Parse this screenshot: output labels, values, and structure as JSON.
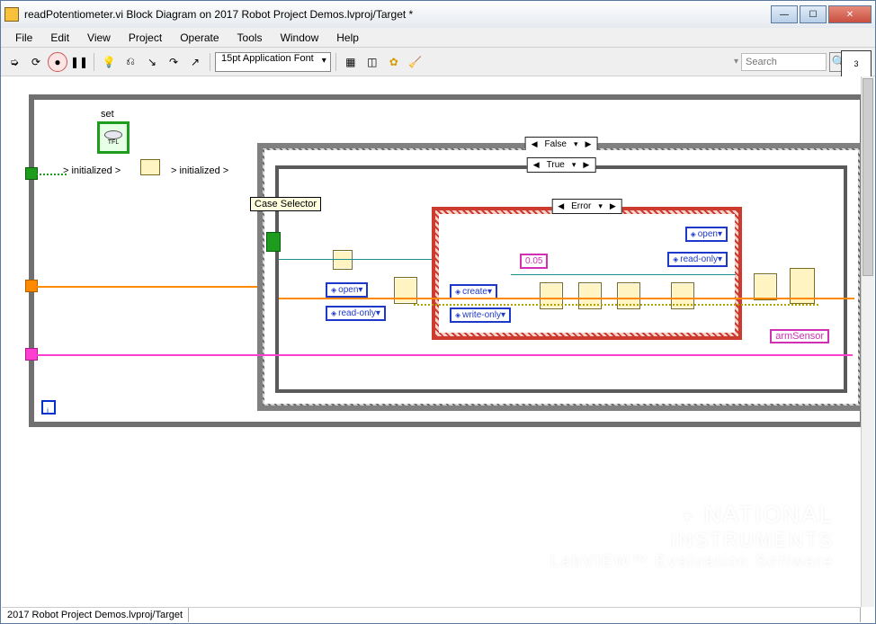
{
  "window": {
    "title": "readPotentiometer.vi Block Diagram on 2017 Robot Project Demos.lvproj/Target *"
  },
  "menu": {
    "file": "File",
    "edit": "Edit",
    "view": "View",
    "project": "Project",
    "operate": "Operate",
    "tools": "Tools",
    "window": "Window",
    "help": "Help"
  },
  "toolbar": {
    "font": "15pt Application Font",
    "search_placeholder": "Search",
    "corner_count": "3"
  },
  "diagram": {
    "tfl_label": "set",
    "tfl_text": "TFL",
    "initialized1": "> initialized >",
    "initialized2": "> initialized >",
    "case_outer": "False",
    "case_inner": "True",
    "case_err": "Error",
    "tooltip": "Case Selector",
    "consts": {
      "open1": "open",
      "readonly1": "read-only",
      "open2": "open",
      "readonly2": "read-only",
      "create": "create",
      "writeonly": "write-only",
      "num": "0.05"
    },
    "armSensor": "armSensor",
    "iter": "i"
  },
  "status": {
    "path": "2017 Robot Project Demos.lvproj/Target"
  },
  "watermark": {
    "l1": "NATIONAL",
    "l2": "INSTRUMENTS",
    "l3": "LabVIEW™ Evaluation Software"
  }
}
